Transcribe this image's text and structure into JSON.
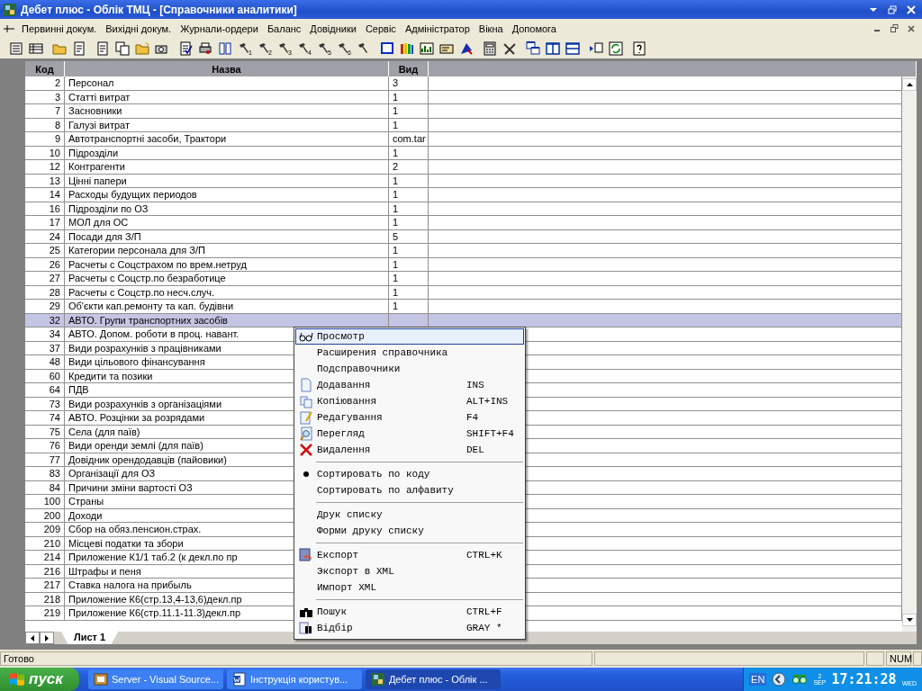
{
  "window": {
    "title": "Дебет плюс - Облік ТМЦ - [Справочники аналитики]"
  },
  "menubar": [
    "Первинні докум.",
    "Вихідні докум.",
    "Журнали-ордери",
    "Баланс",
    "Довідники",
    "Сервіс",
    "Адміністратор",
    "Вікна",
    "Допомога"
  ],
  "toolbar": [
    [
      {
        "kind": "doc"
      },
      {
        "kind": "grid"
      }
    ],
    [
      {
        "kind": "folder"
      },
      {
        "kind": "edit"
      }
    ],
    [
      {
        "kind": "page"
      },
      {
        "kind": "copy"
      },
      {
        "kind": "newfolder"
      },
      {
        "kind": "camera"
      }
    ],
    [
      {
        "kind": "check"
      },
      {
        "kind": "print"
      },
      {
        "kind": "book"
      },
      {
        "kind": "hammer",
        "label": "1"
      },
      {
        "kind": "hammer",
        "label": "2"
      },
      {
        "kind": "hammer",
        "label": "3"
      },
      {
        "kind": "hammer",
        "label": "4"
      },
      {
        "kind": "hammer",
        "label": "5"
      },
      {
        "kind": "hammer",
        "label": "6"
      },
      {
        "kind": "hammer"
      }
    ],
    [
      {
        "kind": "frame"
      },
      {
        "kind": "books"
      },
      {
        "kind": "chart"
      },
      {
        "kind": "card"
      },
      {
        "kind": "flag"
      }
    ],
    [
      {
        "kind": "calc"
      },
      {
        "kind": "tools"
      }
    ],
    [
      {
        "kind": "windows"
      },
      {
        "kind": "split"
      },
      {
        "kind": "hsplit"
      }
    ],
    [
      {
        "kind": "export"
      },
      {
        "kind": "refresh"
      }
    ],
    [
      {
        "kind": "help"
      }
    ]
  ],
  "table": {
    "columns": [
      "Код",
      "Назва",
      "Вид"
    ],
    "rows": [
      {
        "code": "2",
        "name": "Персонал",
        "type": "3",
        "selected": false
      },
      {
        "code": "3",
        "name": "Статті витрат",
        "type": "1",
        "selected": false
      },
      {
        "code": "7",
        "name": "Засновники",
        "type": "1",
        "selected": false
      },
      {
        "code": "8",
        "name": "Галузі витрат",
        "type": "1",
        "selected": false
      },
      {
        "code": "9",
        "name": "Автотранспортні засоби, Трактори",
        "type": "com.tar",
        "selected": false
      },
      {
        "code": "10",
        "name": "Підрозділи",
        "type": "1",
        "selected": false
      },
      {
        "code": "12",
        "name": "Контрагенти",
        "type": "2",
        "selected": false
      },
      {
        "code": "13",
        "name": "Цінні папери",
        "type": "1",
        "selected": false
      },
      {
        "code": "14",
        "name": "Расходы будущих периодов",
        "type": "1",
        "selected": false
      },
      {
        "code": "16",
        "name": "Підрозділи по ОЗ",
        "type": "1",
        "selected": false
      },
      {
        "code": "17",
        "name": "МОЛ для ОС",
        "type": "1",
        "selected": false
      },
      {
        "code": "24",
        "name": "Посади для З/П",
        "type": "5",
        "selected": false
      },
      {
        "code": "25",
        "name": "Категории персонала для З/П",
        "type": "1",
        "selected": false
      },
      {
        "code": "26",
        "name": "Расчеты с Соцстрахом по врем.нетруд",
        "type": "1",
        "selected": false
      },
      {
        "code": "27",
        "name": "Расчеты с Соцстр.по безработице",
        "type": "1",
        "selected": false
      },
      {
        "code": "28",
        "name": "Расчеты с Соцстр.по несч.случ.",
        "type": "1",
        "selected": false
      },
      {
        "code": "29",
        "name": "Об'єкти кап.ремонту та кап. будівни",
        "type": "1",
        "selected": false
      },
      {
        "code": "32",
        "name": "АВТО. Групи транспортних засобів",
        "selected": true
      },
      {
        "code": "34",
        "name": "АВТО. Допом. роботи в проц. навант.",
        "selected": false
      },
      {
        "code": "37",
        "name": "Види розрахунків з працівниками",
        "selected": false
      },
      {
        "code": "48",
        "name": "Види цільового фінансування",
        "selected": false
      },
      {
        "code": "60",
        "name": "Кредити та позики",
        "selected": false
      },
      {
        "code": "64",
        "name": "ПДВ",
        "selected": false
      },
      {
        "code": "73",
        "name": "Види розрахунків з організаціями",
        "selected": false
      },
      {
        "code": "74",
        "name": "АВТО. Розцінки за розрядами",
        "selected": false
      },
      {
        "code": "75",
        "name": "Села (для паїв)",
        "selected": false
      },
      {
        "code": "76",
        "name": "Види оренди землі (для паїв)",
        "selected": false
      },
      {
        "code": "77",
        "name": "Довідник орендодавців (пайовики)",
        "selected": false
      },
      {
        "code": "83",
        "name": "Організації для ОЗ",
        "selected": false
      },
      {
        "code": "84",
        "name": "Причини зміни вартості ОЗ",
        "selected": false
      },
      {
        "code": "100",
        "name": "Страны",
        "selected": false
      },
      {
        "code": "200",
        "name": "Доходи",
        "selected": false
      },
      {
        "code": "209",
        "name": "Сбор на обяз.пенсион.страх.",
        "selected": false
      },
      {
        "code": "210",
        "name": "Місцеві податки та збори",
        "selected": false
      },
      {
        "code": "214",
        "name": "Приложение К1/1 таб.2 (к декл.по пр",
        "selected": false
      },
      {
        "code": "216",
        "name": "Штрафы и пеня",
        "selected": false
      },
      {
        "code": "217",
        "name": "Ставка налога на прибыль",
        "selected": false
      },
      {
        "code": "218",
        "name": "Приложение К6(стр.13,4-13,6)декл.пр",
        "selected": false
      },
      {
        "code": "219",
        "name": "Приложение К6(стр.11.1-11.3)декл.пр",
        "selected": false
      }
    ]
  },
  "sheet_tab": "Лист 1",
  "context_menu": [
    [
      {
        "label": "Просмотр",
        "kind": "glasses",
        "selected": true
      },
      {
        "label": "Расширения справочника",
        "selected": false
      },
      {
        "label": "Подсправочники",
        "selected": false
      },
      {
        "label": "Додавання",
        "shortcut": "INS",
        "kind": "page",
        "selected": false
      },
      {
        "label": "Копіювання",
        "shortcut": "ALT+INS",
        "kind": "copy",
        "selected": false
      },
      {
        "label": "Редагування",
        "shortcut": "F4",
        "kind": "edit",
        "selected": false
      },
      {
        "label": "Перегляд",
        "shortcut": "SHIFT+F4",
        "kind": "preview",
        "selected": false
      },
      {
        "label": "Видалення",
        "shortcut": "DEL",
        "kind": "delete",
        "selected": false
      }
    ],
    [
      {
        "label": "Сортировать по коду",
        "selected": false,
        "checked": true
      },
      {
        "label": "Сортировать по алфавиту",
        "selected": false,
        "checked": false
      }
    ],
    [
      {
        "label": "Друк списку",
        "selected": false
      },
      {
        "label": "Форми друку списку",
        "selected": false
      }
    ],
    [
      {
        "label": "Експорт",
        "shortcut": "CTRL+K",
        "kind": "export",
        "selected": false
      },
      {
        "label": "Экспорт в XML",
        "selected": false
      },
      {
        "label": "Импорт XML",
        "selected": false
      }
    ],
    [
      {
        "label": "Пошук",
        "shortcut": "CTRL+F",
        "kind": "binoculars",
        "selected": false
      },
      {
        "label": "Відбір",
        "shortcut": "GRAY *",
        "kind": "filter",
        "selected": false
      }
    ]
  ],
  "status_bar": {
    "message": "Готово",
    "indicator": "NUM"
  },
  "taskbar": {
    "start": "пуск",
    "tasks": [
      {
        "label": "Server - Visual Source...",
        "kind": "vss",
        "selected": false
      },
      {
        "label": "Інструкція користув...",
        "kind": "word",
        "selected": false
      },
      {
        "label": "Дебет плюс - Облік ...",
        "kind": "app",
        "selected": true
      }
    ],
    "language": "EN",
    "date_day": "2",
    "date_month": "SEP",
    "time": "17:21:28",
    "weekday": "WED"
  }
}
